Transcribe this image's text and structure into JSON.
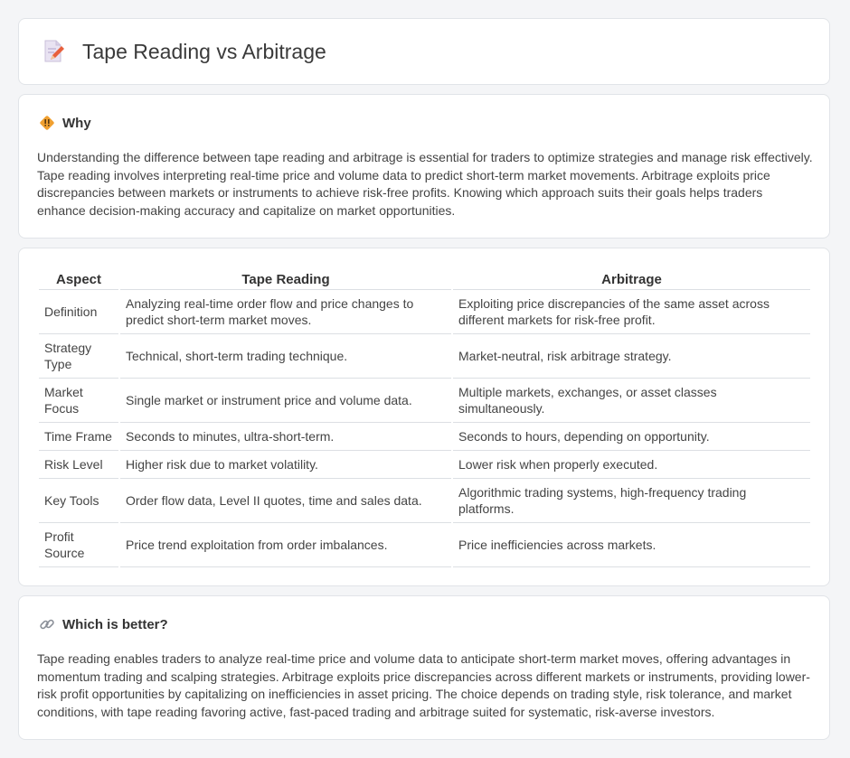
{
  "page": {
    "title": "Tape Reading vs Arbitrage"
  },
  "why": {
    "heading": "Why",
    "text": "Understanding the difference between tape reading and arbitrage is essential for traders to optimize strategies and manage risk effectively. Tape reading involves interpreting real-time price and volume data to predict short-term market movements. Arbitrage exploits price discrepancies between markets or instruments to achieve risk-free profits. Knowing which approach suits their goals helps traders enhance decision-making accuracy and capitalize on market opportunities."
  },
  "comparison": {
    "headers": [
      "Aspect",
      "Tape Reading",
      "Arbitrage"
    ],
    "rows": [
      [
        "Definition",
        "Analyzing real-time order flow and price changes to predict short-term market moves.",
        "Exploiting price discrepancies of the same asset across different markets for risk-free profit."
      ],
      [
        "Strategy Type",
        "Technical, short-term trading technique.",
        "Market-neutral, risk arbitrage strategy."
      ],
      [
        "Market Focus",
        "Single market or instrument price and volume data.",
        "Multiple markets, exchanges, or asset classes simultaneously."
      ],
      [
        "Time Frame",
        "Seconds to minutes, ultra-short-term.",
        "Seconds to hours, depending on opportunity."
      ],
      [
        "Risk Level",
        "Higher risk due to market volatility.",
        "Lower risk when properly executed."
      ],
      [
        "Key Tools",
        "Order flow data, Level II quotes, time and sales data.",
        "Algorithmic trading systems, high-frequency trading platforms."
      ],
      [
        "Profit Source",
        "Price trend exploitation from order imbalances.",
        "Price inefficiencies across markets."
      ]
    ]
  },
  "better": {
    "heading": "Which is better?",
    "text": "Tape reading enables traders to analyze real-time price and volume data to anticipate short-term market moves, offering advantages in momentum trading and scalping strategies. Arbitrage exploits price discrepancies across different markets or instruments, providing lower-risk profit opportunities by capitalizing on inefficiencies in asset pricing. The choice depends on trading style, risk tolerance, and market conditions, with tape reading favoring active, fast-paced trading and arbitrage suited for systematic, risk-averse investors."
  },
  "icons": {
    "title": "document-pencil-icon",
    "why": "diamond-warning-icon",
    "better": "link-icon"
  },
  "colors": {
    "accent_orange": "#f0a030",
    "pencil": "#e8603c",
    "link": "#8a8f98"
  }
}
